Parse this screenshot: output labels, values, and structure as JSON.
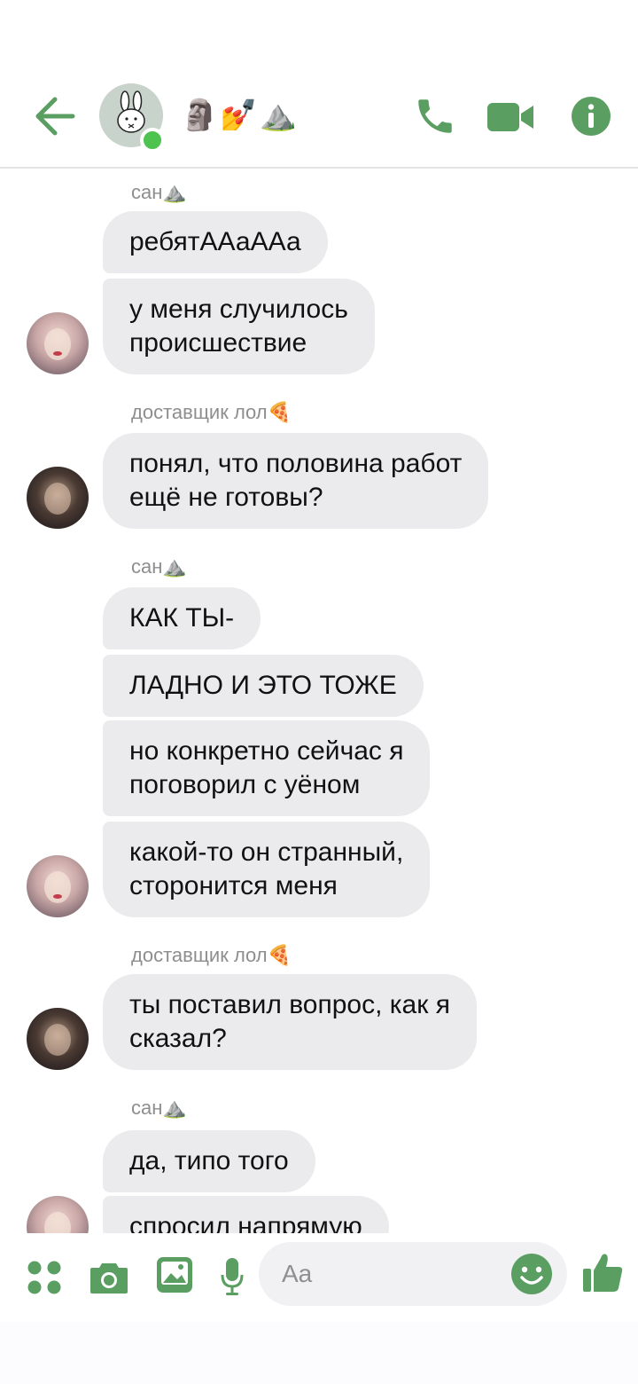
{
  "colors": {
    "accent": "#5a9e62",
    "bubble": "#ebebed",
    "online": "#4fc34f"
  },
  "header": {
    "back_icon": "arrow-left-icon",
    "title": "🗿💅⛰️",
    "call_icon": "phone-icon",
    "video_icon": "video-camera-icon",
    "info_icon": "info-icon"
  },
  "messages": [
    {
      "type": "sender",
      "text": "сан⛰️"
    },
    {
      "type": "bubble",
      "text": "ребятААаААа"
    },
    {
      "type": "bubble",
      "text": "у меня случилось\nпроисшествие"
    },
    {
      "type": "sender",
      "text": "доставщик лол🍕"
    },
    {
      "type": "bubble",
      "text": "понял, что половина работ\nещё не готовы?"
    },
    {
      "type": "sender",
      "text": "сан⛰️"
    },
    {
      "type": "bubble",
      "text": "КАК ТЫ-"
    },
    {
      "type": "bubble",
      "text": "ЛАДНО И ЭТО ТОЖЕ"
    },
    {
      "type": "bubble",
      "text": "но конкретно сейчас я\nпоговорил с уёном"
    },
    {
      "type": "bubble",
      "text": "какой-то он странный,\nсторонится меня"
    },
    {
      "type": "sender",
      "text": "доставщик лол🍕"
    },
    {
      "type": "bubble",
      "text": "ты поставил вопрос, как я\nсказал?"
    },
    {
      "type": "sender",
      "text": "сан⛰️"
    },
    {
      "type": "bubble",
      "text": "да, типо того"
    },
    {
      "type": "bubble",
      "text": "спросил напрямую"
    }
  ],
  "composer": {
    "placeholder": "Aa",
    "apps_icon": "apps-grid-icon",
    "camera_icon": "camera-icon",
    "gallery_icon": "image-icon",
    "mic_icon": "microphone-icon",
    "emoji_icon": "smiley-icon",
    "like_icon": "thumbs-up-icon"
  }
}
